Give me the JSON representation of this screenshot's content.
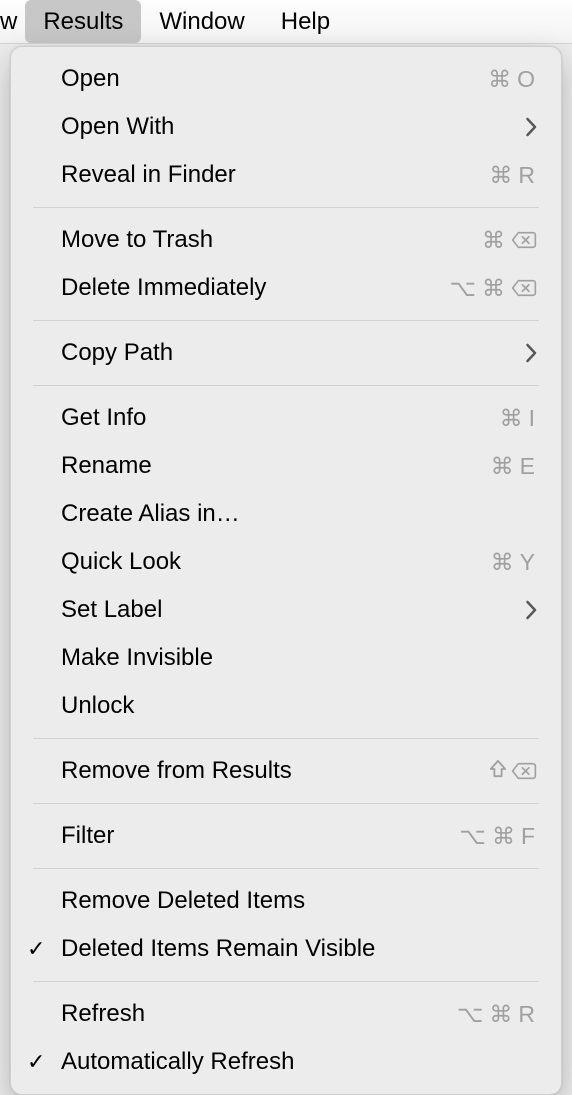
{
  "menubar": {
    "partial": "w",
    "items": [
      {
        "label": "Results",
        "active": true
      },
      {
        "label": "Window",
        "active": false
      },
      {
        "label": "Help",
        "active": false
      }
    ]
  },
  "menu": {
    "groups": [
      [
        {
          "label": "Open",
          "shortcut": {
            "cmd": true,
            "key": "O"
          }
        },
        {
          "label": "Open With",
          "submenu": true
        },
        {
          "label": "Reveal in Finder",
          "shortcut": {
            "cmd": true,
            "key": "R"
          }
        }
      ],
      [
        {
          "label": "Move to Trash",
          "shortcut": {
            "cmd": true,
            "del": true
          }
        },
        {
          "label": "Delete Immediately",
          "shortcut": {
            "opt": true,
            "cmd": true,
            "del": true
          }
        }
      ],
      [
        {
          "label": "Copy Path",
          "submenu": true
        }
      ],
      [
        {
          "label": "Get Info",
          "shortcut": {
            "cmd": true,
            "key": "I"
          }
        },
        {
          "label": "Rename",
          "shortcut": {
            "cmd": true,
            "key": "E"
          }
        },
        {
          "label": "Create Alias in…"
        },
        {
          "label": "Quick Look",
          "shortcut": {
            "cmd": true,
            "key": "Y"
          }
        },
        {
          "label": "Set Label",
          "submenu": true
        },
        {
          "label": "Make Invisible"
        },
        {
          "label": "Unlock"
        }
      ],
      [
        {
          "label": "Remove from Results",
          "shortcut": {
            "shift": true,
            "del": true
          }
        }
      ],
      [
        {
          "label": "Filter",
          "shortcut": {
            "opt": true,
            "cmd": true,
            "key": "F"
          }
        }
      ],
      [
        {
          "label": "Remove Deleted Items"
        },
        {
          "label": "Deleted Items Remain Visible",
          "checked": true
        }
      ],
      [
        {
          "label": "Refresh",
          "shortcut": {
            "opt": true,
            "cmd": true,
            "key": "R"
          }
        },
        {
          "label": "Automatically Refresh",
          "checked": true
        }
      ]
    ]
  }
}
